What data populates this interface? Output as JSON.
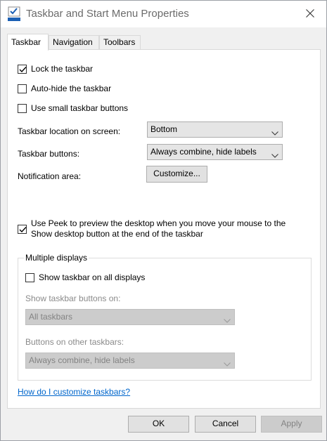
{
  "window": {
    "title": "Taskbar and Start Menu Properties",
    "icon": "taskbar-properties-icon",
    "close_icon": "close-icon"
  },
  "tabs": [
    {
      "label": "Taskbar",
      "active": true
    },
    {
      "label": "Navigation",
      "active": false
    },
    {
      "label": "Toolbars",
      "active": false
    }
  ],
  "taskbar": {
    "lock": {
      "label": "Lock the taskbar",
      "checked": true
    },
    "autohide": {
      "label": "Auto-hide the taskbar",
      "checked": false
    },
    "small_buttons": {
      "label": "Use small taskbar buttons",
      "checked": false
    },
    "location": {
      "label": "Taskbar location on screen:",
      "value": "Bottom"
    },
    "buttons": {
      "label": "Taskbar buttons:",
      "value": "Always combine, hide labels"
    },
    "notification": {
      "label": "Notification area:",
      "button": "Customize..."
    },
    "peek": {
      "label_line1": "Use Peek to preview the desktop when you move your mouse to the",
      "label_line2": "Show desktop button at the end of the taskbar",
      "checked": true
    }
  },
  "multiple_displays": {
    "legend": "Multiple displays",
    "show_all": {
      "label": "Show taskbar on all displays",
      "checked": false
    },
    "show_buttons_on": {
      "label": "Show taskbar buttons on:",
      "value": "All taskbars",
      "enabled": false
    },
    "buttons_other": {
      "label": "Buttons on other taskbars:",
      "value": "Always combine, hide labels",
      "enabled": false
    }
  },
  "help_link": "How do I customize taskbars?",
  "footer": {
    "ok": "OK",
    "cancel": "Cancel",
    "apply": "Apply"
  },
  "colors": {
    "accent": "#0066cc",
    "disabled_bg": "#cccccc",
    "window_bg": "#f0f0f0"
  }
}
